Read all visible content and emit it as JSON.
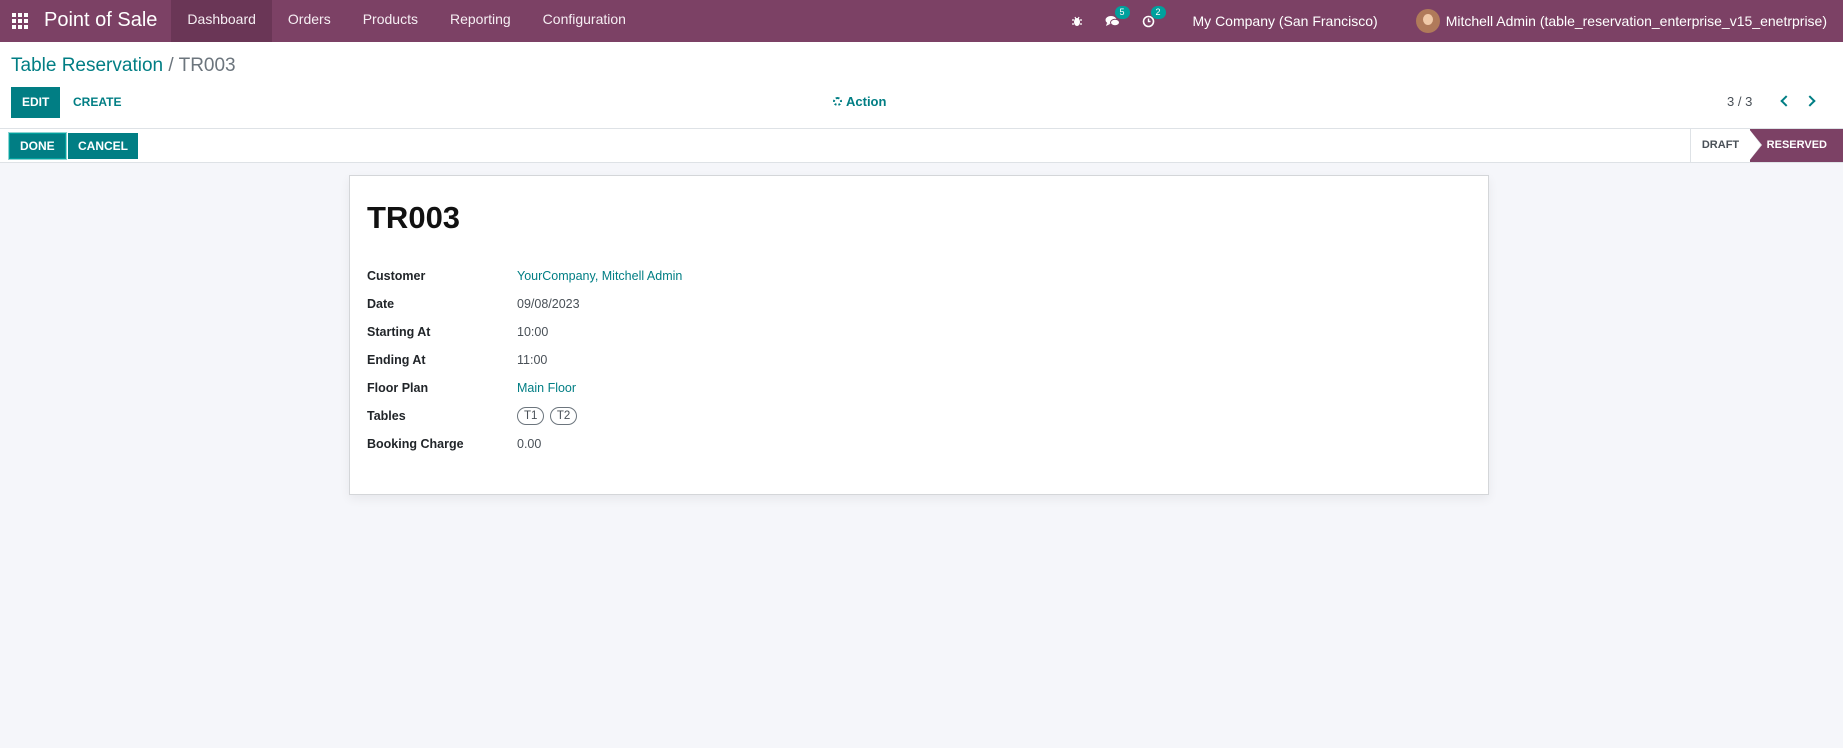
{
  "navbar": {
    "app_title": "Point of Sale",
    "menu": [
      "Dashboard",
      "Orders",
      "Products",
      "Reporting",
      "Configuration"
    ],
    "active_menu": "Dashboard",
    "icons": [
      "bug-icon",
      "chat-icon",
      "activity-clock-icon"
    ],
    "messages_badge": "5",
    "activities_badge": "2",
    "company": "My Company (San Francisco)",
    "user": "Mitchell Admin (table_reservation_enterprise_v15_enetrprise)"
  },
  "control_panel": {
    "breadcrumb_parent": "Table Reservation",
    "breadcrumb_separator": "/",
    "breadcrumb_current": "TR003",
    "edit_label": "EDIT",
    "create_label": "CREATE",
    "action_label": "Action",
    "pager": "3 / 3"
  },
  "statusbar": {
    "done_label": "DONE",
    "cancel_label": "CANCEL",
    "stages": [
      "DRAFT",
      "RESERVED"
    ],
    "current_stage": "RESERVED"
  },
  "record": {
    "title": "TR003",
    "fields": [
      {
        "label": "Customer",
        "value": "YourCompany, Mitchell Admin"
      },
      {
        "label": "Date",
        "value": "09/08/2023"
      },
      {
        "label": "Starting At",
        "value": "10:00"
      },
      {
        "label": "Ending At",
        "value": "11:00"
      },
      {
        "label": "Floor Plan",
        "value": "Main Floor"
      },
      {
        "label": "Tables",
        "tags": [
          "T1",
          "T2"
        ]
      },
      {
        "label": "Booking Charge",
        "value": "0.00"
      }
    ]
  },
  "colors": {
    "brand": "#7c4165",
    "accent": "#017e84",
    "background": "#f5f6fa"
  }
}
